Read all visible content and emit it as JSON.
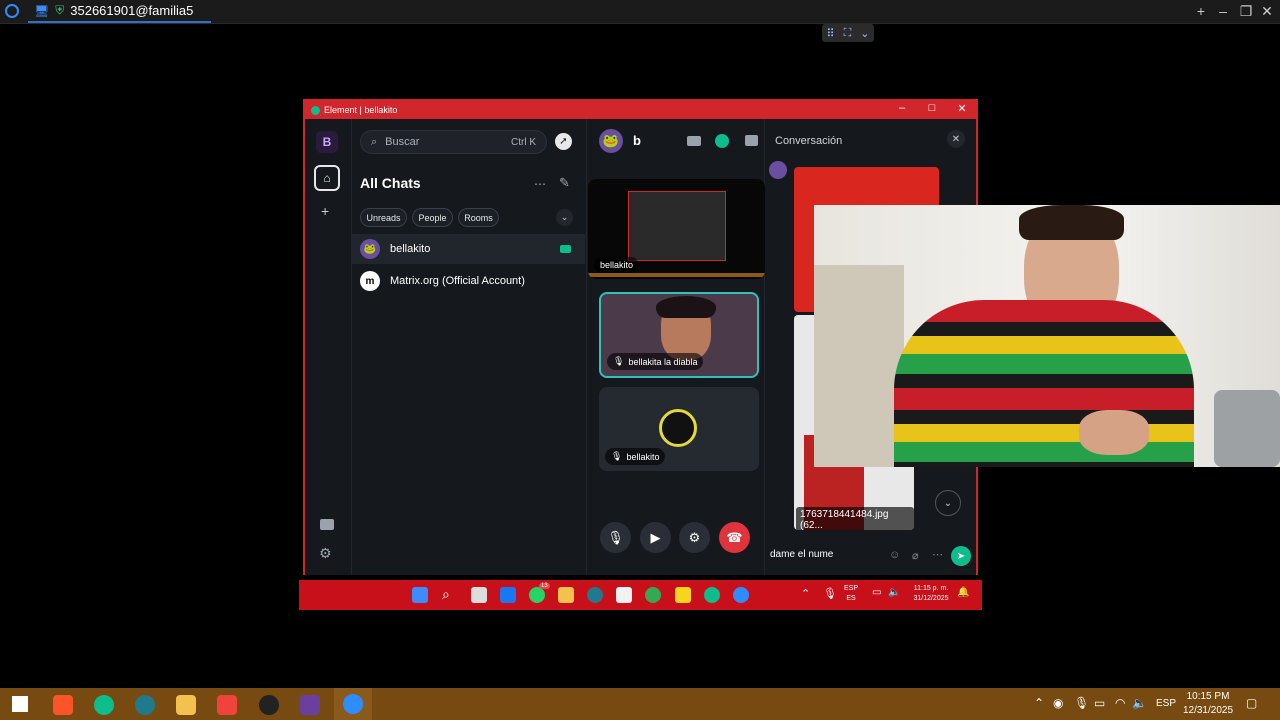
{
  "remote_titlebar": {
    "connection_id": "352661901@familia5"
  },
  "element_window": {
    "title": "Element | bellakito",
    "space_initial": "B",
    "search_placeholder": "Buscar",
    "search_shortcut": "Ctrl K",
    "heading": "All Chats",
    "filters": [
      "Unreads",
      "People",
      "Rooms"
    ],
    "rooms": [
      {
        "name": "bellakito",
        "avatar": "🐸"
      },
      {
        "name": "Matrix.org (Official Account)",
        "avatar": "m"
      }
    ],
    "call": {
      "room_name": "b",
      "participants": [
        "bellakito",
        "bellakita la diabla",
        "bellakito"
      ]
    },
    "thread": {
      "title": "Conversación",
      "attachment": "1763718441484.jpg (62...",
      "composer_text": "dame el nume"
    }
  },
  "inner_taskbar": {
    "lang_top": "ESP",
    "lang_bottom": "ES",
    "time": "11:15 p. m.",
    "date": "31/12/2025",
    "whatsapp_badge": "13"
  },
  "outer_taskbar": {
    "lang": "ESP",
    "time": "10:15 PM",
    "date": "12/31/2025"
  },
  "colors": {
    "window_border": "#d2262d",
    "outer_taskbar": "#764a10",
    "accent_green": "#0dbd8b"
  }
}
